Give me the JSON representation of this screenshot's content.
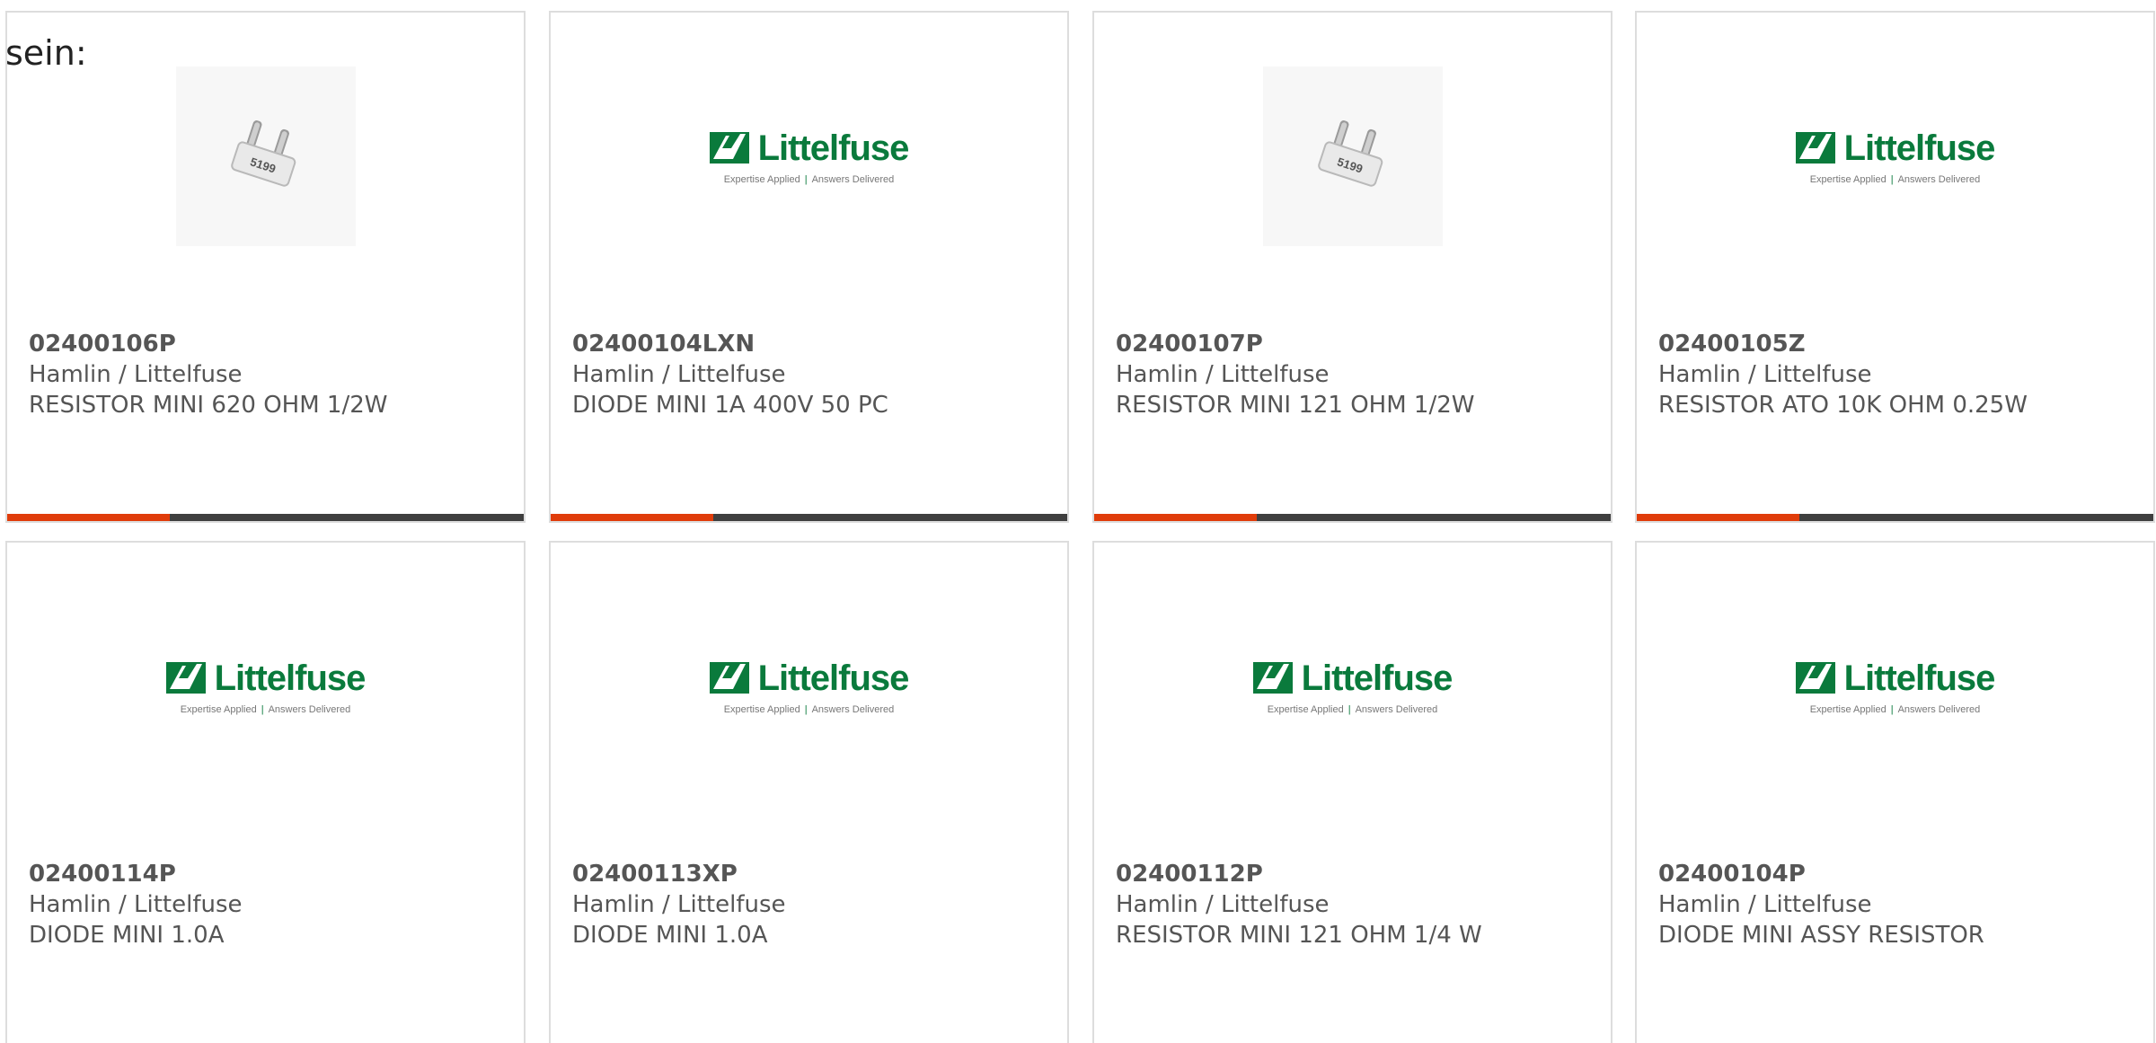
{
  "intro": "sein:",
  "brand": {
    "logo_text": "Littelfuse",
    "tagline_left": "Expertise Applied",
    "tagline_sep": "|",
    "tagline_right": "Answers Delivered",
    "logo_color": "#0a7a3c"
  },
  "colors": {
    "accent_bar": "#e03c0a",
    "dark_bar": "#3f3f3f",
    "card_border": "#dddddd",
    "text": "#555555"
  },
  "products": [
    {
      "part": "02400106P",
      "maker": "Hamlin / Littelfuse",
      "desc": "RESISTOR MINI 620 OHM 1/2W",
      "image": "fuse-photo"
    },
    {
      "part": "02400104LXN",
      "maker": "Hamlin / Littelfuse",
      "desc": "DIODE MINI 1A 400V 50 PC",
      "image": "littelfuse-logo"
    },
    {
      "part": "02400107P",
      "maker": "Hamlin / Littelfuse",
      "desc": "RESISTOR MINI 121 OHM 1/2W",
      "image": "fuse-photo"
    },
    {
      "part": "02400105Z",
      "maker": "Hamlin / Littelfuse",
      "desc": "RESISTOR ATO 10K OHM 0.25W",
      "image": "littelfuse-logo"
    },
    {
      "part": "02400114P",
      "maker": "Hamlin / Littelfuse",
      "desc": "DIODE MINI 1.0A",
      "image": "littelfuse-logo"
    },
    {
      "part": "02400113XP",
      "maker": "Hamlin / Littelfuse",
      "desc": "DIODE MINI 1.0A",
      "image": "littelfuse-logo"
    },
    {
      "part": "02400112P",
      "maker": "Hamlin / Littelfuse",
      "desc": "RESISTOR MINI 121 OHM 1/4 W",
      "image": "littelfuse-logo"
    },
    {
      "part": "02400104P",
      "maker": "Hamlin / Littelfuse",
      "desc": "DIODE MINI ASSY RESISTOR",
      "image": "littelfuse-logo"
    }
  ]
}
